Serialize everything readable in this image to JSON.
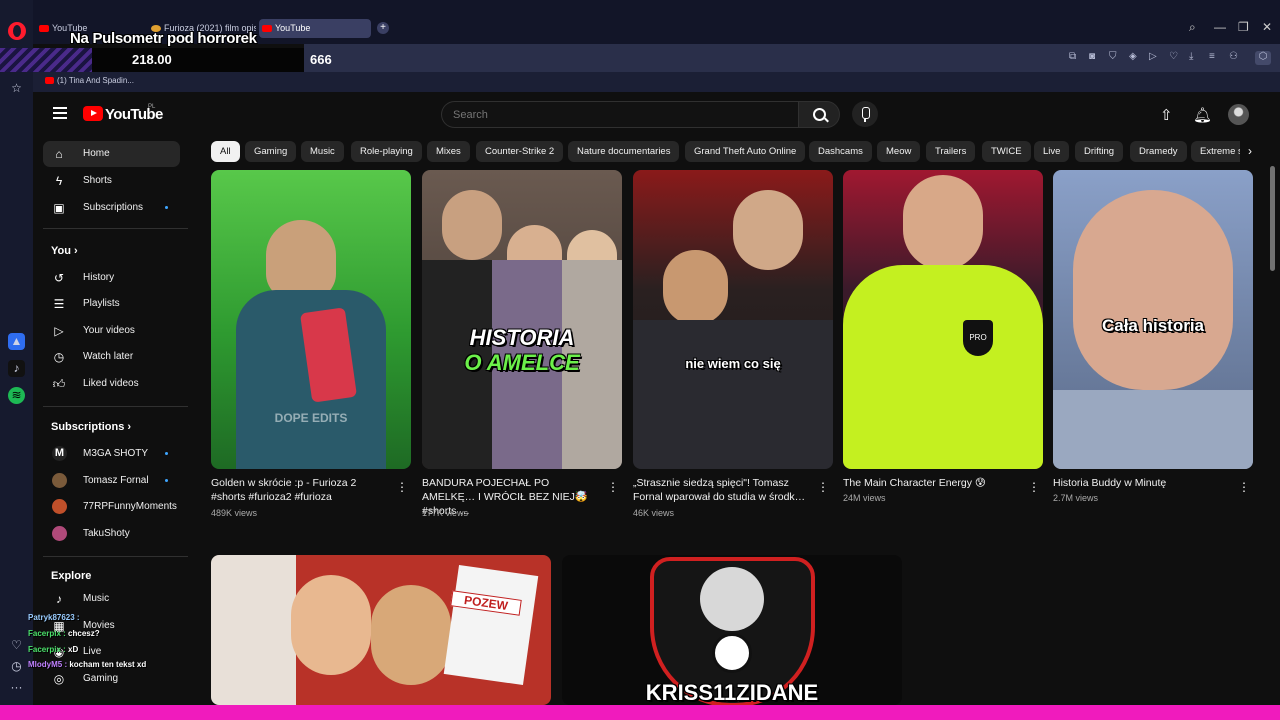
{
  "browser": {
    "tabs": [
      {
        "label": "YouTube",
        "active": false
      },
      {
        "label": "Furioza (2021) film opis -",
        "active": false
      },
      {
        "label": "YouTube",
        "active": true
      }
    ],
    "bookmark": "(1) Tina And Spadin...",
    "new_tab": "+"
  },
  "overlay": {
    "title": "Na Pulsometr pod horrorek",
    "counter_left": "218.00",
    "counter_right": "666"
  },
  "header": {
    "logo_text": "YouTube",
    "region": "PL",
    "search_placeholder": "Search"
  },
  "nav": {
    "main": [
      {
        "label": "Home",
        "icon": "home-icon",
        "active": true
      },
      {
        "label": "Shorts",
        "icon": "shorts-icon"
      },
      {
        "label": "Subscriptions",
        "icon": "subscriptions-icon",
        "dot": true
      }
    ],
    "you_title": "You",
    "you": [
      {
        "label": "History",
        "icon": "history-icon"
      },
      {
        "label": "Playlists",
        "icon": "playlists-icon"
      },
      {
        "label": "Your videos",
        "icon": "your-videos-icon"
      },
      {
        "label": "Watch later",
        "icon": "watch-later-icon"
      },
      {
        "label": "Liked videos",
        "icon": "liked-videos-icon"
      }
    ],
    "subs_title": "Subscriptions",
    "subs": [
      {
        "label": "M3GA SHOTY",
        "color": "#222222"
      },
      {
        "label": "Tomasz Fornal",
        "color": "#7a5a3a"
      },
      {
        "label": "77RPFunnyMoments",
        "color": "#c0502a"
      },
      {
        "label": "TakuShoty",
        "color": "#b04a7a"
      }
    ],
    "explore_title": "Explore",
    "explore": [
      {
        "label": "Music",
        "icon": "music-icon"
      },
      {
        "label": "Movies",
        "icon": "movies-icon"
      },
      {
        "label": "Live",
        "icon": "live-icon"
      },
      {
        "label": "Gaming",
        "icon": "gaming-icon"
      }
    ]
  },
  "chips": [
    "All",
    "Gaming",
    "Music",
    "Role-playing",
    "Mixes",
    "Counter-Strike 2",
    "Nature documentaries",
    "Grand Theft Auto Online",
    "Dashcams",
    "Meow",
    "Trailers",
    "TWICE",
    "Live",
    "Drifting",
    "Dramedy",
    "Extreme s"
  ],
  "shorts": [
    {
      "title": "Golden w skrócie :p - Furioza 2 #shorts #furioza2 #furioza",
      "views": "489K views",
      "caption": "DOPE EDITS",
      "bg": "#3fae3c"
    },
    {
      "title": "BANDURA POJECHAŁ PO AMELKĘ… I WRÓCIŁ BEZ NIEJ🤯 #shorts …",
      "views": "177K views",
      "caption_line1": "HISTORIA",
      "caption_line2": "O AMELCE",
      "bg": "#5a4a42"
    },
    {
      "title": "„Strasznie siedzą spięci\"! Tomasz Fornal wparował do studia w środk…",
      "views": "46K views",
      "caption": "nie wiem co się",
      "bg": "#3a2e2e"
    },
    {
      "title": "The Main Character Energy 😰",
      "views": "24M views",
      "bg": "#b8e020"
    },
    {
      "title": "Historia Buddy w Minutę",
      "views": "2.7M views",
      "caption": "Cała historia",
      "bg": "#6a7fa0"
    }
  ],
  "videos": [
    {
      "caption": "POZEW",
      "bg": "#a8302a"
    },
    {
      "caption": "KRISS11ZIDANE",
      "bg": "#111111"
    }
  ],
  "chat": [
    {
      "user": "Patryk87623 :",
      "text": ""
    },
    {
      "user": "Facerpix :",
      "text": "chcesz?"
    },
    {
      "user": "Facerpix :",
      "text": "xD"
    },
    {
      "user": "MlodyM5 :",
      "text": "kocham ten tekst xd"
    }
  ]
}
